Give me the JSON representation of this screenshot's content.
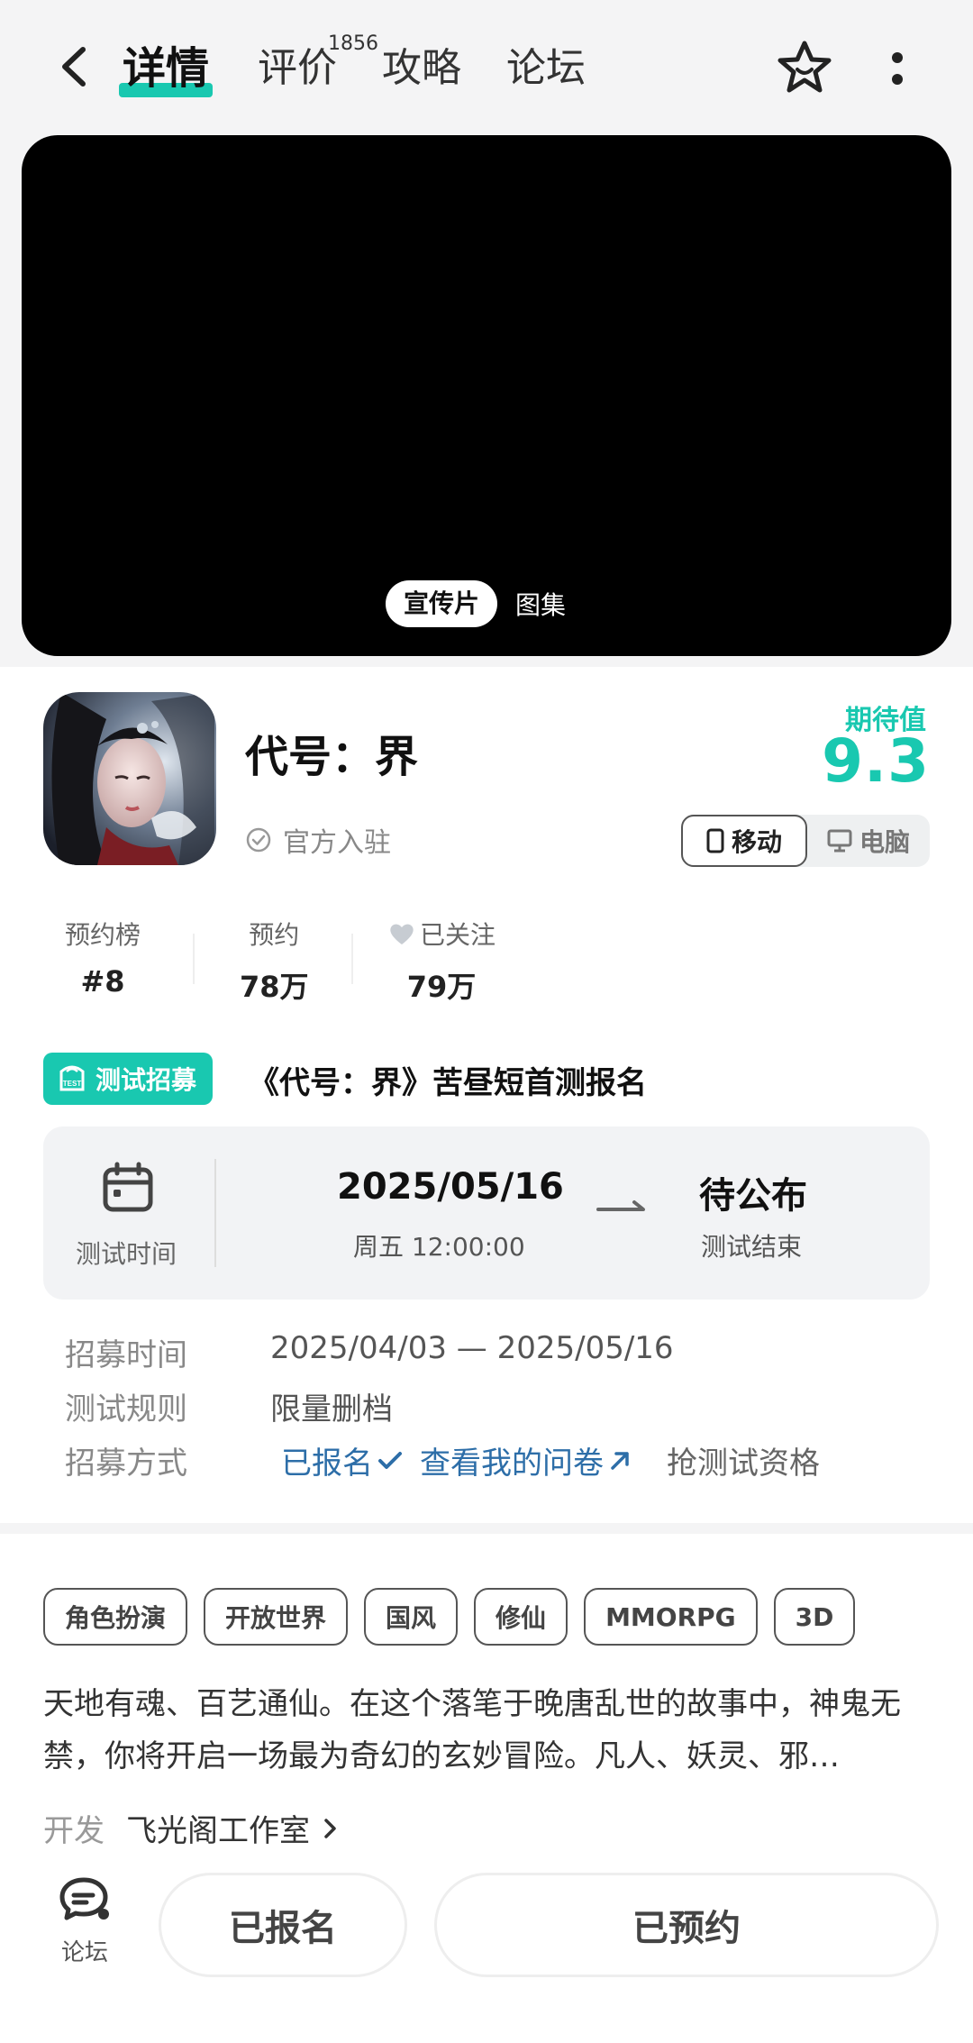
{
  "header": {
    "tabs": {
      "detail": "详情",
      "review": "评价",
      "review_count": "1856",
      "guide": "攻略",
      "forum": "论坛"
    }
  },
  "media": {
    "tab_trailer": "宣传片",
    "tab_gallery": "图集"
  },
  "game": {
    "title": "代号：界",
    "official": "官方入驻",
    "expect_label": "期待值",
    "expect_score": "9.3",
    "platform_mobile": "移动",
    "platform_pc": "电脑"
  },
  "stats": {
    "rank_label": "预约榜",
    "rank_value": "#8",
    "reserve_label": "预约",
    "reserve_value": "78万",
    "follow_label": "已关注",
    "follow_value": "79万"
  },
  "recruit": {
    "badge": "测试招募",
    "title": "《代号：界》苦昼短首测报名",
    "card": {
      "time_label": "测试时间",
      "start_date": "2025/05/16",
      "start_time": "周五  12:00:00",
      "end_date": "待公布",
      "end_label": "测试结束"
    },
    "rows": {
      "period_label": "招募时间",
      "period_value": "2025/04/03 — 2025/05/16",
      "rule_label": "测试规则",
      "rule_value": "限量删档",
      "method_label": "招募方式",
      "signed": "已报名",
      "questionnaire": "查看我的问卷",
      "grab": "抢测试资格"
    }
  },
  "tags": [
    "角色扮演",
    "开放世界",
    "国风",
    "修仙",
    "MMORPG",
    "3D"
  ],
  "description": "天地有魂、百艺通仙。在这个落笔于晚唐乱世的故事中，神鬼无禁，你将开启一场最为奇幻的玄妙冒险。凡人、妖灵、邪…",
  "developer": {
    "label": "开发",
    "name": "飞光阁工作室"
  },
  "bottom": {
    "forum": "论坛",
    "signed": "已报名",
    "reserved": "已预约"
  },
  "colors": {
    "accent": "#19c8b0",
    "link": "#2d6ea8"
  }
}
